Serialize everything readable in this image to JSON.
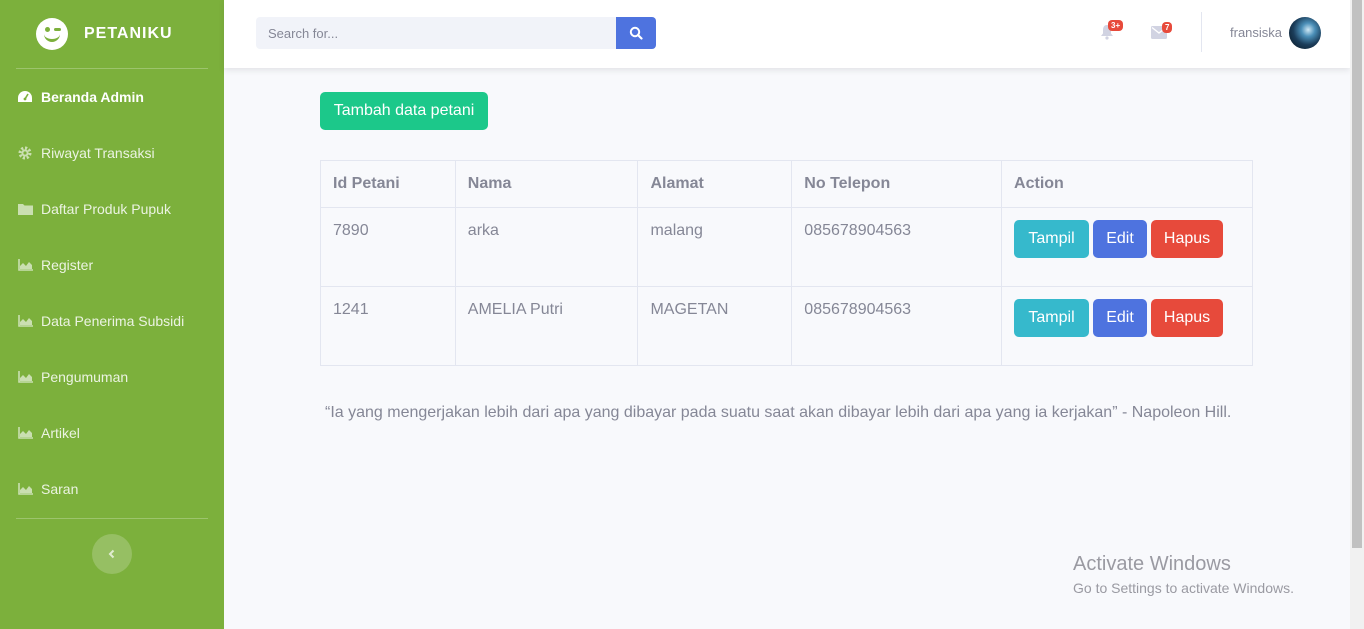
{
  "sidebar": {
    "brand": "PETANIKU",
    "items": [
      {
        "label": "Beranda Admin",
        "icon": "tachometer-icon",
        "active": true
      },
      {
        "label": "Riwayat Transaksi",
        "icon": "cog-icon"
      },
      {
        "label": "Daftar Produk Pupuk",
        "icon": "folder-icon"
      },
      {
        "label": "Register",
        "icon": "chart-area-icon"
      },
      {
        "label": "Data Penerima Subsidi",
        "icon": "chart-area-icon"
      },
      {
        "label": "Pengumuman",
        "icon": "chart-area-icon"
      },
      {
        "label": "Artikel",
        "icon": "chart-area-icon"
      },
      {
        "label": "Saran",
        "icon": "chart-area-icon"
      }
    ]
  },
  "topbar": {
    "search_placeholder": "Search for...",
    "alerts_badge": "3+",
    "messages_badge": "7",
    "user_name": "fransiska"
  },
  "main": {
    "add_button": "Tambah data petani",
    "table": {
      "headers": [
        "Id Petani",
        "Nama",
        "Alamat",
        "No Telepon",
        "Action"
      ],
      "rows": [
        {
          "id": "7890",
          "nama": "arka",
          "alamat": "malang",
          "telepon": "085678904563"
        },
        {
          "id": "1241",
          "nama": "AMELIA Putri",
          "alamat": "MAGETAN",
          "telepon": "085678904563"
        }
      ],
      "actions": {
        "show": "Tampil",
        "edit": "Edit",
        "delete": "Hapus"
      }
    },
    "quote": "“Ia yang mengerjakan lebih dari apa yang dibayar pada suatu saat akan dibayar lebih dari apa yang ia kerjakan” - Napoleon Hill."
  },
  "watermark": {
    "title": "Activate Windows",
    "subtitle": "Go to Settings to activate Windows."
  },
  "colors": {
    "sidebar": "#7cb03c",
    "primary": "#4e73df",
    "success": "#1cc88a",
    "info": "#36b9cc",
    "danger": "#e74a3b"
  }
}
